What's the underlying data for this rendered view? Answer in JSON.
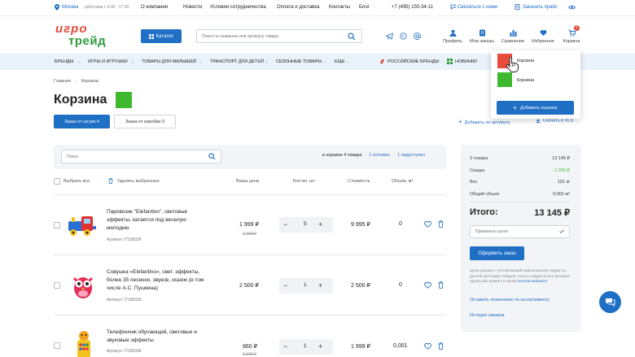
{
  "topbar": {
    "city": "Москва",
    "hours": "работаем с 9:30 - 17:30",
    "links": [
      "О компании",
      "Новости",
      "Условия сотрудничества",
      "Оплата и доставка",
      "Контакты",
      "Блог"
    ],
    "phone": "+7 (495) 150-34-11",
    "contact": "Связаться с нами",
    "price": "Заказать прайс"
  },
  "header": {
    "logo_top": "игро",
    "logo_bottom": "трейд",
    "catalog": "Каталог",
    "search_placeholder": "Поиск по названию или артикулу товара",
    "icons": [
      "Профиль",
      "Мои заказы",
      "Сравнение",
      "Избранное",
      "Корзина"
    ],
    "cart_badge": "2"
  },
  "nav": [
    "БРЕНДЫ",
    "ИГРЫ И ИГРУШКИ",
    "ТОВАРЫ ДЛЯ МАЛЫШЕЙ",
    "ТРАНСПОРТ ДЛЯ ДЕТЕЙ",
    "СЕЗОННЫЕ ТОВАРЫ",
    "ЕЩЕ",
    "РОССИЙСКИЕ БРЕНДЫ",
    "НОВИНКИ"
  ],
  "dropdown": {
    "items": [
      "Корзина",
      "Корзина"
    ],
    "colors": [
      "#e94b3c",
      "#3db82f"
    ],
    "add": "Добавить корзину"
  },
  "breadcrumb": [
    "Главная",
    "Корзина"
  ],
  "page": {
    "title": "Корзина",
    "color": "#3db82f",
    "tab_active": "Заказ от штуки 4",
    "tab_inactive": "Заказ от коробки 0",
    "add_by_sku": "Добавить по артикулу",
    "download": "Скачать в XLS"
  },
  "cart": {
    "search_placeholder": "Поиск",
    "count_text": "в корзине 4 товара",
    "postponed": "1 отложен",
    "unavailable": "1 недоступен",
    "select_all": "Выбрать все",
    "delete_selected": "Удалить выбранные",
    "headers": [
      "Ваша цена",
      "Кол-во, шт",
      "Стоимость",
      "Объем, м³"
    ],
    "rows": [
      {
        "name": "Паровозик \"Elefantino\", световые эффекты, катается под веселую мелодию",
        "sku": "Артикул: IT108336",
        "price": "1 999 ₽",
        "old_price": "2 150 ₽",
        "qty": "5",
        "total": "9 995 ₽",
        "volume": "0"
      },
      {
        "name": "Совушка «Elefantino», свет. эффекты, более 35 песенок, звуков, сказок (в том числе А.С. Пушкина)",
        "sku": "Артикул: IT108336",
        "price": "2 500 ₽",
        "old_price": "",
        "qty": "1",
        "total": "2 500 ₽",
        "volume": "0"
      },
      {
        "name": "Телефончик обучающий, световые и звуковые эффекты",
        "sku": "Артикул: IT108336",
        "price": "860 ₽",
        "old_price": "1 100 ₽",
        "qty": "1",
        "total": "1 999 ₽",
        "volume": "0,001"
      }
    ]
  },
  "summary": {
    "rows": [
      {
        "label": "3 товара",
        "value": "13 145 ₽"
      },
      {
        "label": "Скидка",
        "value": "- 1 200 ₽"
      },
      {
        "label": "Вес",
        "value": "101 кг"
      },
      {
        "label": "Общий объем",
        "value": "0,001 м³"
      }
    ],
    "total_label": "Итого:",
    "total_value": "13 145 ₽",
    "promo_placeholder": "Применить купон",
    "checkout": "Оформить заказ",
    "note": "Цена указана с учетом Вашей персональной скидки по данной категории товаров. Узнать скидки на все ценовые группы Вы можете в своем",
    "note_link": "личном кабинете",
    "wish": "Оставить пожелание по ассортименту",
    "history": "История заказов",
    "discount_color": "#3db82f"
  }
}
